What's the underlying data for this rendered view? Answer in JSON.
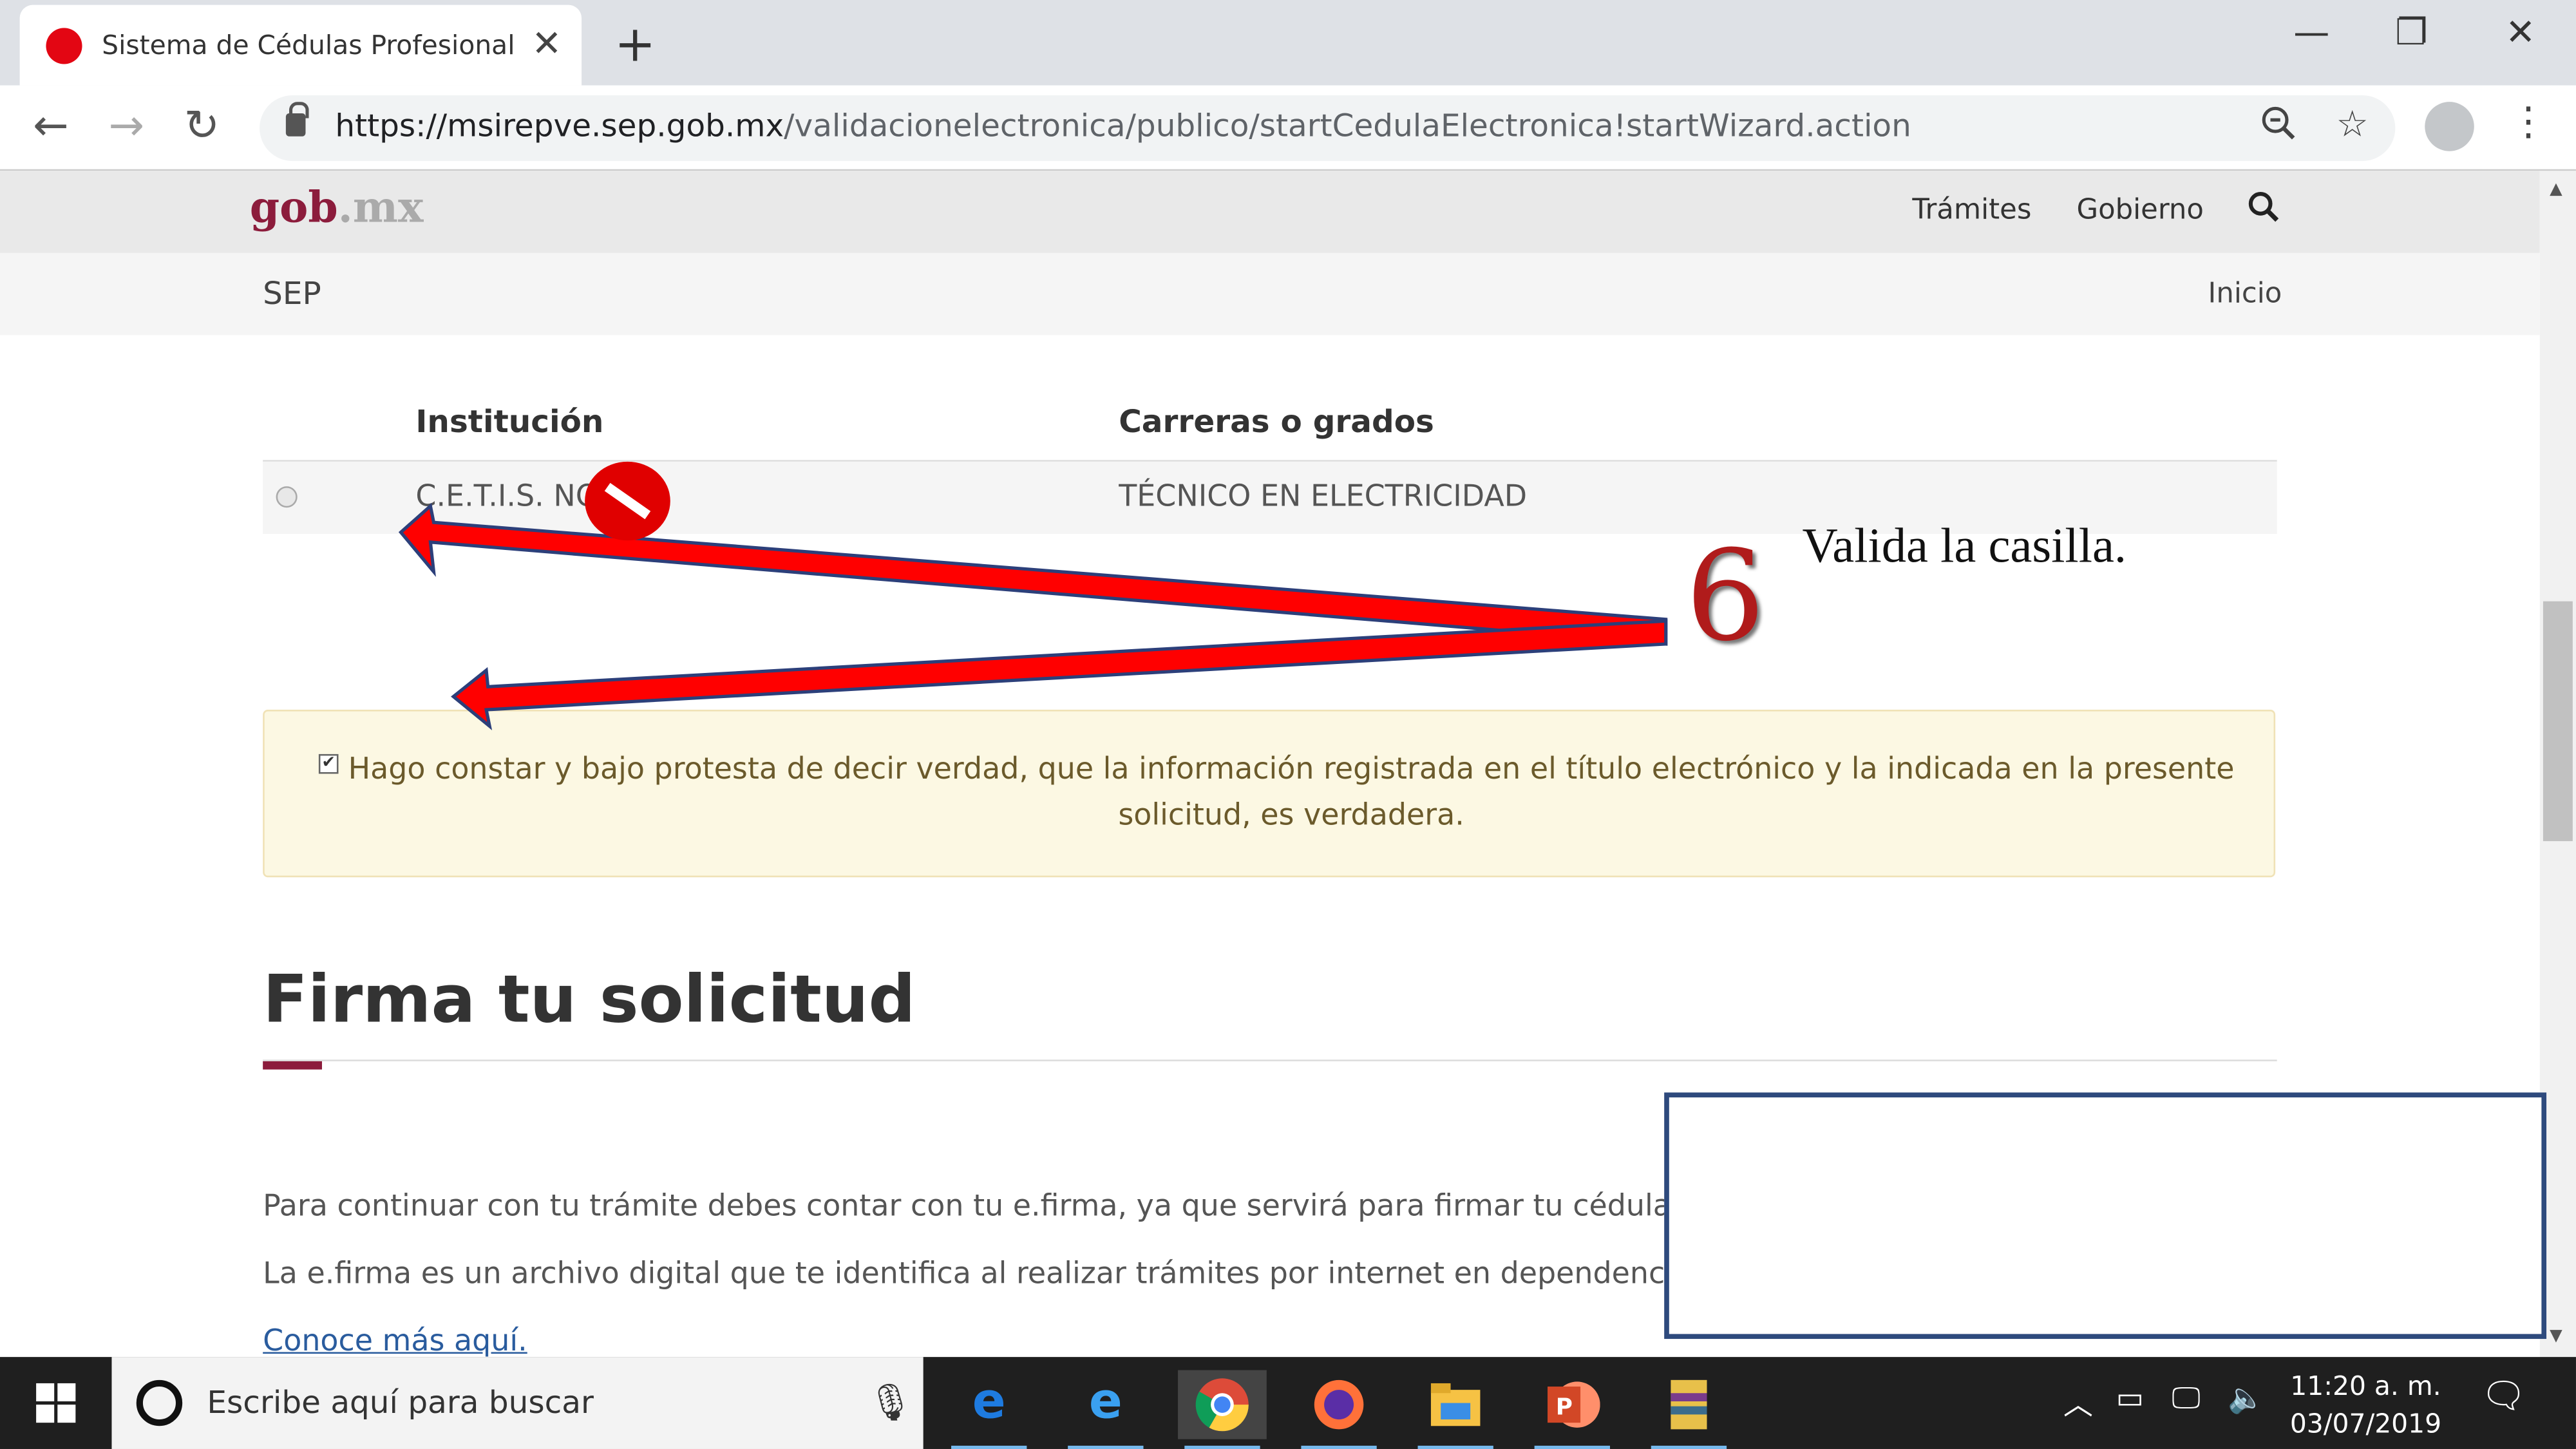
{
  "browser": {
    "tab_title": "Sistema de Cédulas Profesionales",
    "new_tab_glyph": "+",
    "close_glyph": "✕",
    "url_host": "https://msirepve.sep.gob.mx",
    "url_path": "/validacionelectronica/publico/startCedulaElectronica!startWizard.action"
  },
  "gob_header": {
    "logo_gob": "gob",
    "logo_mx": ".mx",
    "nav": [
      "Trámites",
      "Gobierno"
    ]
  },
  "sep_bar": {
    "title": "SEP",
    "inicio": "Inicio"
  },
  "table": {
    "headers": [
      "Institución",
      "Carreras o grados"
    ],
    "rows": [
      {
        "institucion": "C.E.T.I.S. NO",
        "carrera": "TÉCNICO EN ELECTRICIDAD"
      }
    ]
  },
  "notice": {
    "text": "Hago constar y bajo protesta de decir verdad, que la información registrada en el título electrónico y la indicada en la presente solicitud, es verdadera.",
    "checked": true
  },
  "section": {
    "title": "Firma tu solicitud",
    "para1": "Para continuar con tu trámite debes contar con tu e.firma, ya que servirá para firmar tu cédula pro",
    "para2": "La e.firma es un archivo digital que te identifica al realizar trámites por internet en dependencias d",
    "link": "Conoce más aquí."
  },
  "annotation": {
    "number": "6",
    "text": "Valida la casilla.",
    "arrow_color": "#ff0000"
  },
  "taskbar": {
    "search_placeholder": "Escribe aquí para buscar",
    "time": "11:20 a. m.",
    "date": "03/07/2019",
    "apps": [
      "edge-icon",
      "ie-icon",
      "chrome-icon",
      "firefox-icon",
      "file-explorer-icon",
      "powerpoint-icon",
      "winrar-icon"
    ]
  },
  "colors": {
    "gob_primary": "#8c1c3c",
    "notice_bg": "#fcf8e3",
    "link": "#2a5c9e"
  }
}
